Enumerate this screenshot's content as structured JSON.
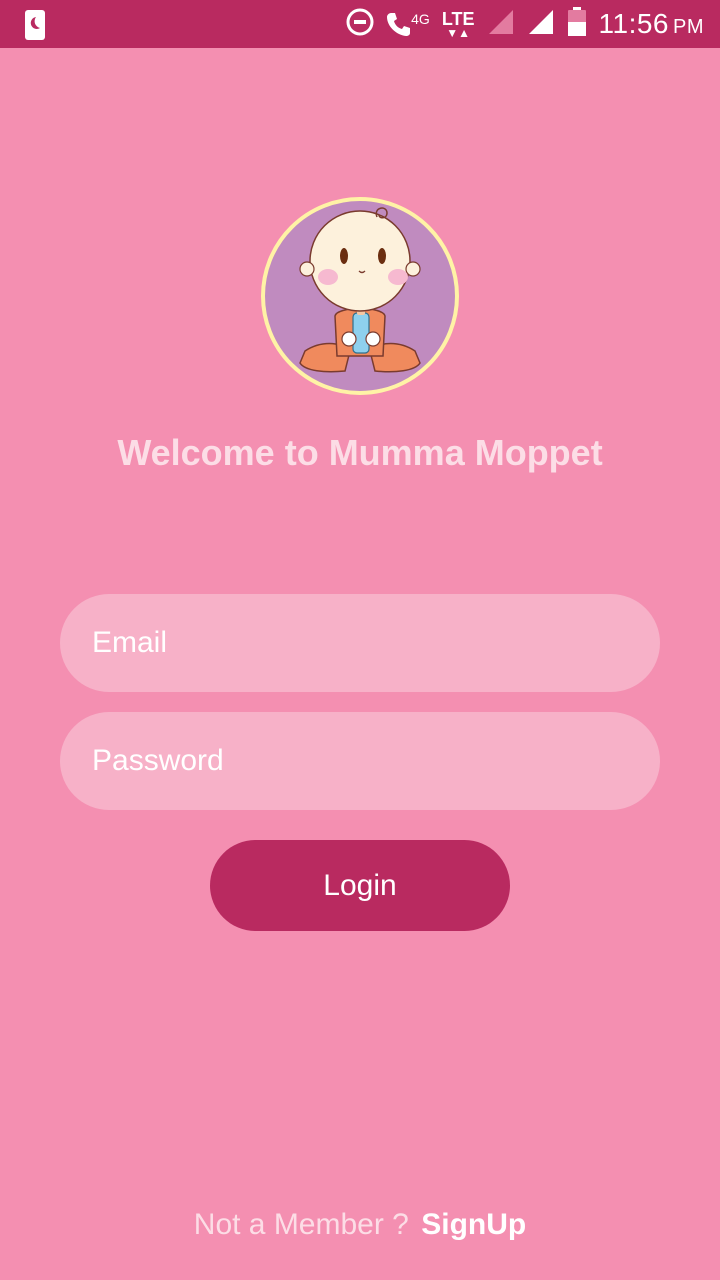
{
  "status_bar": {
    "network_label": "4G",
    "lte_label": "LTE",
    "time": "11:56",
    "ampm": "PM",
    "icons": [
      "sim-moon-icon",
      "do-not-disturb-icon",
      "volte-call-icon",
      "lte-data-icon",
      "signal-weak-icon",
      "signal-strong-icon",
      "battery-icon"
    ]
  },
  "welcome": {
    "title": "Welcome to Mumma Moppet"
  },
  "login_form": {
    "email_placeholder": "Email",
    "password_placeholder": "Password",
    "login_label": "Login"
  },
  "footer": {
    "prompt": "Not a Member ?",
    "signup_label": "SignUp"
  },
  "colors": {
    "background": "#f48fb1",
    "status_bar": "#b92a60",
    "field_bg": "#f7b1c8",
    "button": "#b92a60",
    "avatar_bg": "#c08bbf",
    "avatar_border": "#fff3a6"
  }
}
